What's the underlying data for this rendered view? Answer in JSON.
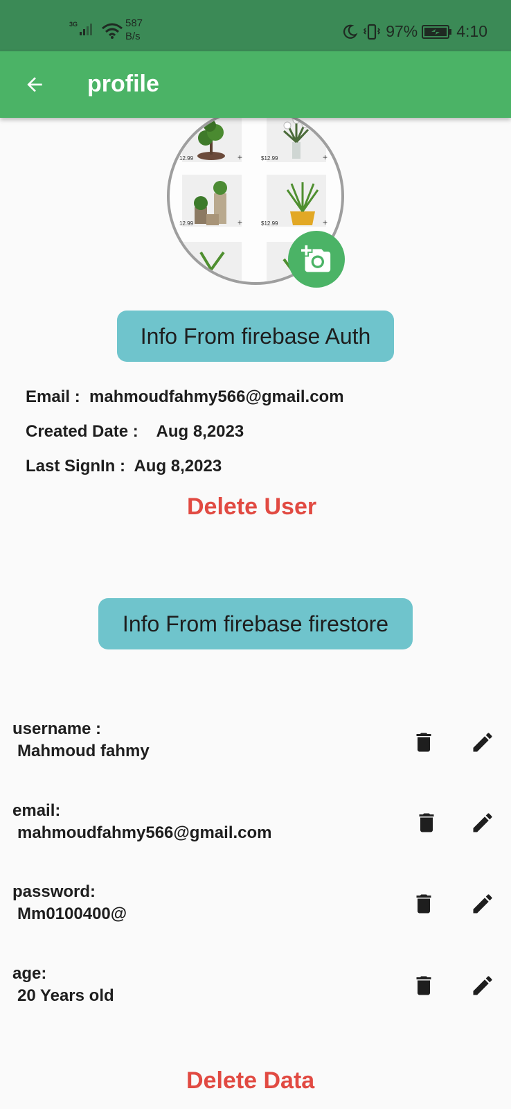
{
  "status_bar": {
    "network_type": "3G",
    "speed_value": "587",
    "speed_unit": "B/s",
    "battery_percent": "97%",
    "time": "4:10"
  },
  "app_bar": {
    "title": "profile"
  },
  "avatar": {
    "prices": [
      "12.99",
      "$12.99",
      "12.99",
      "$12.99"
    ]
  },
  "auth_section": {
    "header": "Info From firebase Auth",
    "email_label": "Email :",
    "email_value": "mahmoudfahmy566@gmail.com",
    "created_label": "Created Date :",
    "created_value": "Aug 8,2023",
    "signin_label": "Last SignIn :",
    "signin_value": "Aug 8,2023",
    "delete_user": "Delete User"
  },
  "firestore_section": {
    "header": "Info From firebase firestore",
    "fields": [
      {
        "label": "username :",
        "value": "Mahmoud fahmy"
      },
      {
        "label": "email:",
        "value": "mahmoudfahmy566@gmail.com"
      },
      {
        "label": "password:",
        "value": "Mm0100400@"
      },
      {
        "label": "age:",
        "value": "20 Years old"
      }
    ],
    "delete_data": "Delete Data"
  },
  "colors": {
    "status_bar": "#3b8a56",
    "app_bar": "#4bb366",
    "pill": "#6fc4cc",
    "danger": "#e14a42"
  },
  "icons": {
    "back": "arrow-back-icon",
    "camera": "add-a-photo-icon",
    "delete": "trash-icon",
    "edit": "pencil-icon"
  }
}
